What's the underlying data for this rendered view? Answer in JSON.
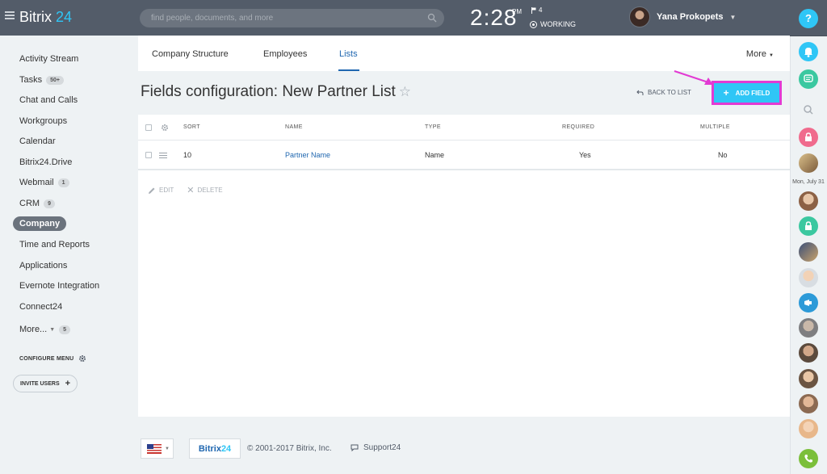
{
  "header": {
    "logo_text": "Bitrix",
    "logo_num": "24",
    "search_placeholder": "find people, documents, and more",
    "time": "2:28",
    "ampm": "PM",
    "flag_count": "4",
    "status": "WORKING",
    "user_name": "Yana Prokopets"
  },
  "sidebar": {
    "items": [
      {
        "label": "Activity Stream"
      },
      {
        "label": "Tasks",
        "badge": "50+"
      },
      {
        "label": "Chat and Calls"
      },
      {
        "label": "Workgroups"
      },
      {
        "label": "Calendar"
      },
      {
        "label": "Bitrix24.Drive"
      },
      {
        "label": "Webmail",
        "badge": "1"
      },
      {
        "label": "CRM",
        "badge": "9"
      },
      {
        "label": "Company"
      },
      {
        "label": "Time and Reports"
      },
      {
        "label": "Applications"
      },
      {
        "label": "Evernote Integration"
      },
      {
        "label": "Connect24"
      },
      {
        "label": "More...",
        "badge": "5"
      }
    ],
    "configure_menu": "CONFIGURE MENU",
    "invite_users": "INVITE USERS"
  },
  "tabs": {
    "items": [
      {
        "label": "Company Structure"
      },
      {
        "label": "Employees"
      },
      {
        "label": "Lists"
      }
    ],
    "more": "More"
  },
  "page": {
    "title": "Fields configuration: New Partner List",
    "back_to_list": "BACK TO LIST",
    "add_field": "ADD FIELD"
  },
  "grid": {
    "columns": [
      "SORT",
      "NAME",
      "TYPE",
      "REQUIRED",
      "MULTIPLE"
    ],
    "rows": [
      {
        "sort": "10",
        "name": "Partner Name",
        "type": "Name",
        "required": "Yes",
        "multiple": "No"
      }
    ],
    "edit": "EDIT",
    "delete": "DELETE"
  },
  "rightbar": {
    "date": "Mon, July 31",
    "help": "?"
  },
  "footer": {
    "logo_text": "Bitrix",
    "logo_num": "24",
    "copyright": "© 2001-2017 Bitrix, Inc.",
    "support": "Support24"
  },
  "colors": {
    "header_bg": "#535c69",
    "accent": "#2fc6f6",
    "link": "#2067b0",
    "highlight": "#e23ad3"
  }
}
